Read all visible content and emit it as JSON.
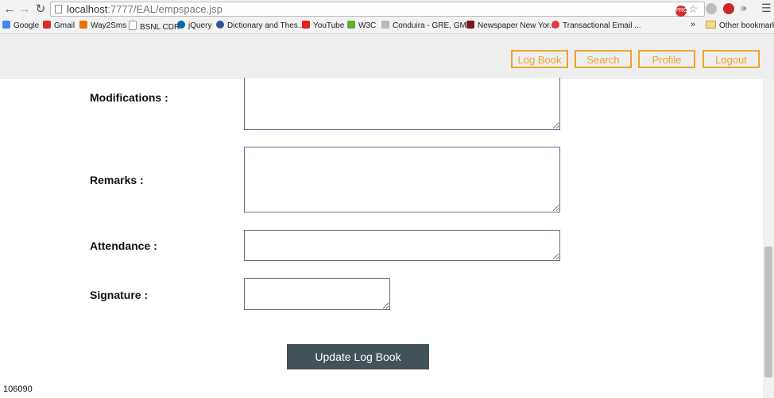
{
  "browser": {
    "url_host": "localhost",
    "url_path": ":7777/EAL/empspace.jsp",
    "bookmarks": [
      {
        "label": "Google",
        "color": "#4285f4"
      },
      {
        "label": "Gmail",
        "color": "#d93025"
      },
      {
        "label": "Way2Sms",
        "color": "#e8710a"
      },
      {
        "label": "BSNL CDR",
        "color": "#cfcfcf"
      },
      {
        "label": "jQuery",
        "color": "#0769ad"
      },
      {
        "label": "Dictionary and Thes...",
        "color": "#2b5797"
      },
      {
        "label": "YouTube",
        "color": "#e62117"
      },
      {
        "label": "W3C",
        "color": "#5ab031"
      },
      {
        "label": "Conduira - GRE, GM...",
        "color": "#bbbbbb"
      },
      {
        "label": "Newspaper New Yor...",
        "color": "#7a1b1b"
      },
      {
        "label": "Transactional Email ...",
        "color": "#e03a3a"
      }
    ],
    "overflow_chevron": "»",
    "other_bookmarks": "Other bookmarks"
  },
  "nav": {
    "log_book": "Log Book",
    "search": "Search",
    "profile": "Profile",
    "logout": "Logout",
    "accent_color": "#f0a22c"
  },
  "form": {
    "modifications_label": "Modifications :",
    "remarks_label": "Remarks :",
    "attendance_label": "Attendance :",
    "signature_label": "Signature :",
    "modifications_value": "",
    "remarks_value": "",
    "attendance_value": "",
    "signature_value": "",
    "submit_label": "Update Log Book"
  },
  "footer": {
    "id_text": "106090"
  }
}
